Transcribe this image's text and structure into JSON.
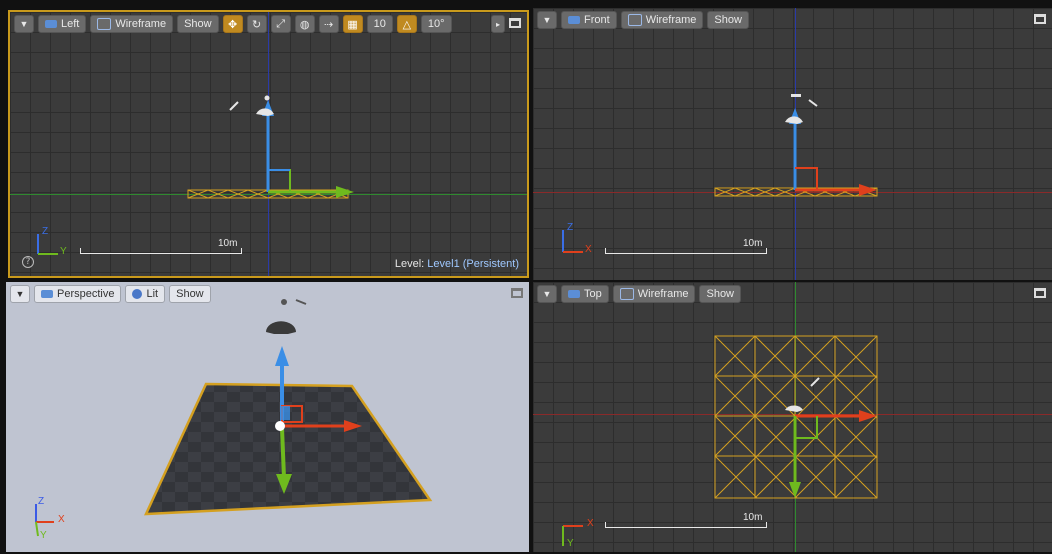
{
  "viewports": {
    "left": {
      "view_label": "Left",
      "mode_label": "Wireframe",
      "show_label": "Show",
      "grid_snap_value": "10",
      "rotation_snap_value": "10°",
      "scale_label": "10m",
      "level_prefix": "Level:",
      "level_name": "Level1 (Persistent)",
      "axis_a": "Z",
      "axis_b": "Y"
    },
    "front": {
      "view_label": "Front",
      "mode_label": "Wireframe",
      "show_label": "Show",
      "scale_label": "10m",
      "axis_a": "Z",
      "axis_b": "X"
    },
    "perspective": {
      "view_label": "Perspective",
      "mode_label": "Lit",
      "show_label": "Show",
      "axis_a": "Z",
      "axis_b": "X",
      "axis_c": "Y"
    },
    "top": {
      "view_label": "Top",
      "mode_label": "Wireframe",
      "show_label": "Show",
      "scale_label": "10m",
      "axis_a": "X",
      "axis_b": "Y"
    }
  },
  "colors": {
    "selection_border": "#c99a1c",
    "axis_x": "#e0401c",
    "axis_y": "#6fba1e",
    "axis_z": "#3a8ee6",
    "wire_orange": "#d4a020"
  },
  "icons": [
    "chevron-down-icon",
    "maximize-icon",
    "camera-icon",
    "directional-light-icon",
    "translate-gizmo-icon",
    "grid-snap-icon",
    "rotation-snap-icon",
    "help-icon"
  ]
}
